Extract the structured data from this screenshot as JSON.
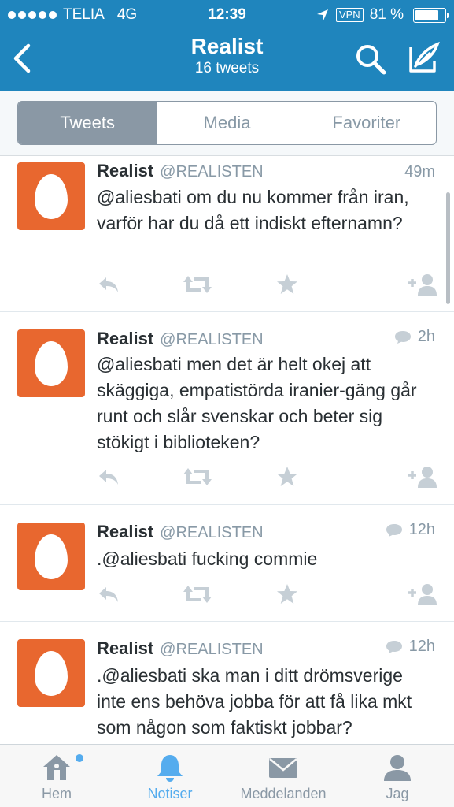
{
  "status_bar": {
    "carrier": "TELIA",
    "network": "4G",
    "time": "12:39",
    "vpn": "VPN",
    "battery": "81 %",
    "battery_level": 0.81
  },
  "nav": {
    "title": "Realist",
    "subtitle": "16 tweets"
  },
  "segments": [
    {
      "label": "Tweets",
      "active": true
    },
    {
      "label": "Media",
      "active": false
    },
    {
      "label": "Favoriter",
      "active": false
    }
  ],
  "tweets": [
    {
      "name": "Realist",
      "handle": "@REALISTEN",
      "time": "49m",
      "conversation": false,
      "text": "@aliesbati om du nu kommer från iran, varför har du då ett indiskt efternamn?"
    },
    {
      "name": "Realist",
      "handle": "@REALISTEN",
      "time": "2h",
      "conversation": true,
      "text": "@aliesbati men det är helt okej att skäggiga, empatistörda iranier-gäng går runt och slår svenskar och beter sig stökigt i biblioteken?"
    },
    {
      "name": "Realist",
      "handle": "@REALISTEN",
      "time": "12h",
      "conversation": true,
      "text": ".@aliesbati fucking commie"
    },
    {
      "name": "Realist",
      "handle": "@REALISTEN",
      "time": "12h",
      "conversation": true,
      "text": ".@aliesbati ska man i ditt drömsverige inte ens behöva jobba för att få lika mkt som någon som faktiskt jobbar?"
    }
  ],
  "tabbar": {
    "items": [
      {
        "label": "Hem",
        "icon": "home-icon",
        "active": false
      },
      {
        "label": "Notiser",
        "icon": "bell-icon",
        "active": true
      },
      {
        "label": "Meddelanden",
        "icon": "envelope-icon",
        "active": false
      },
      {
        "label": "Jag",
        "icon": "person-icon",
        "active": false
      }
    ]
  },
  "colors": {
    "header_blue": "#1f85bd",
    "accent": "#55acee",
    "avatar_orange": "#e8672f",
    "muted": "#8899a6"
  }
}
